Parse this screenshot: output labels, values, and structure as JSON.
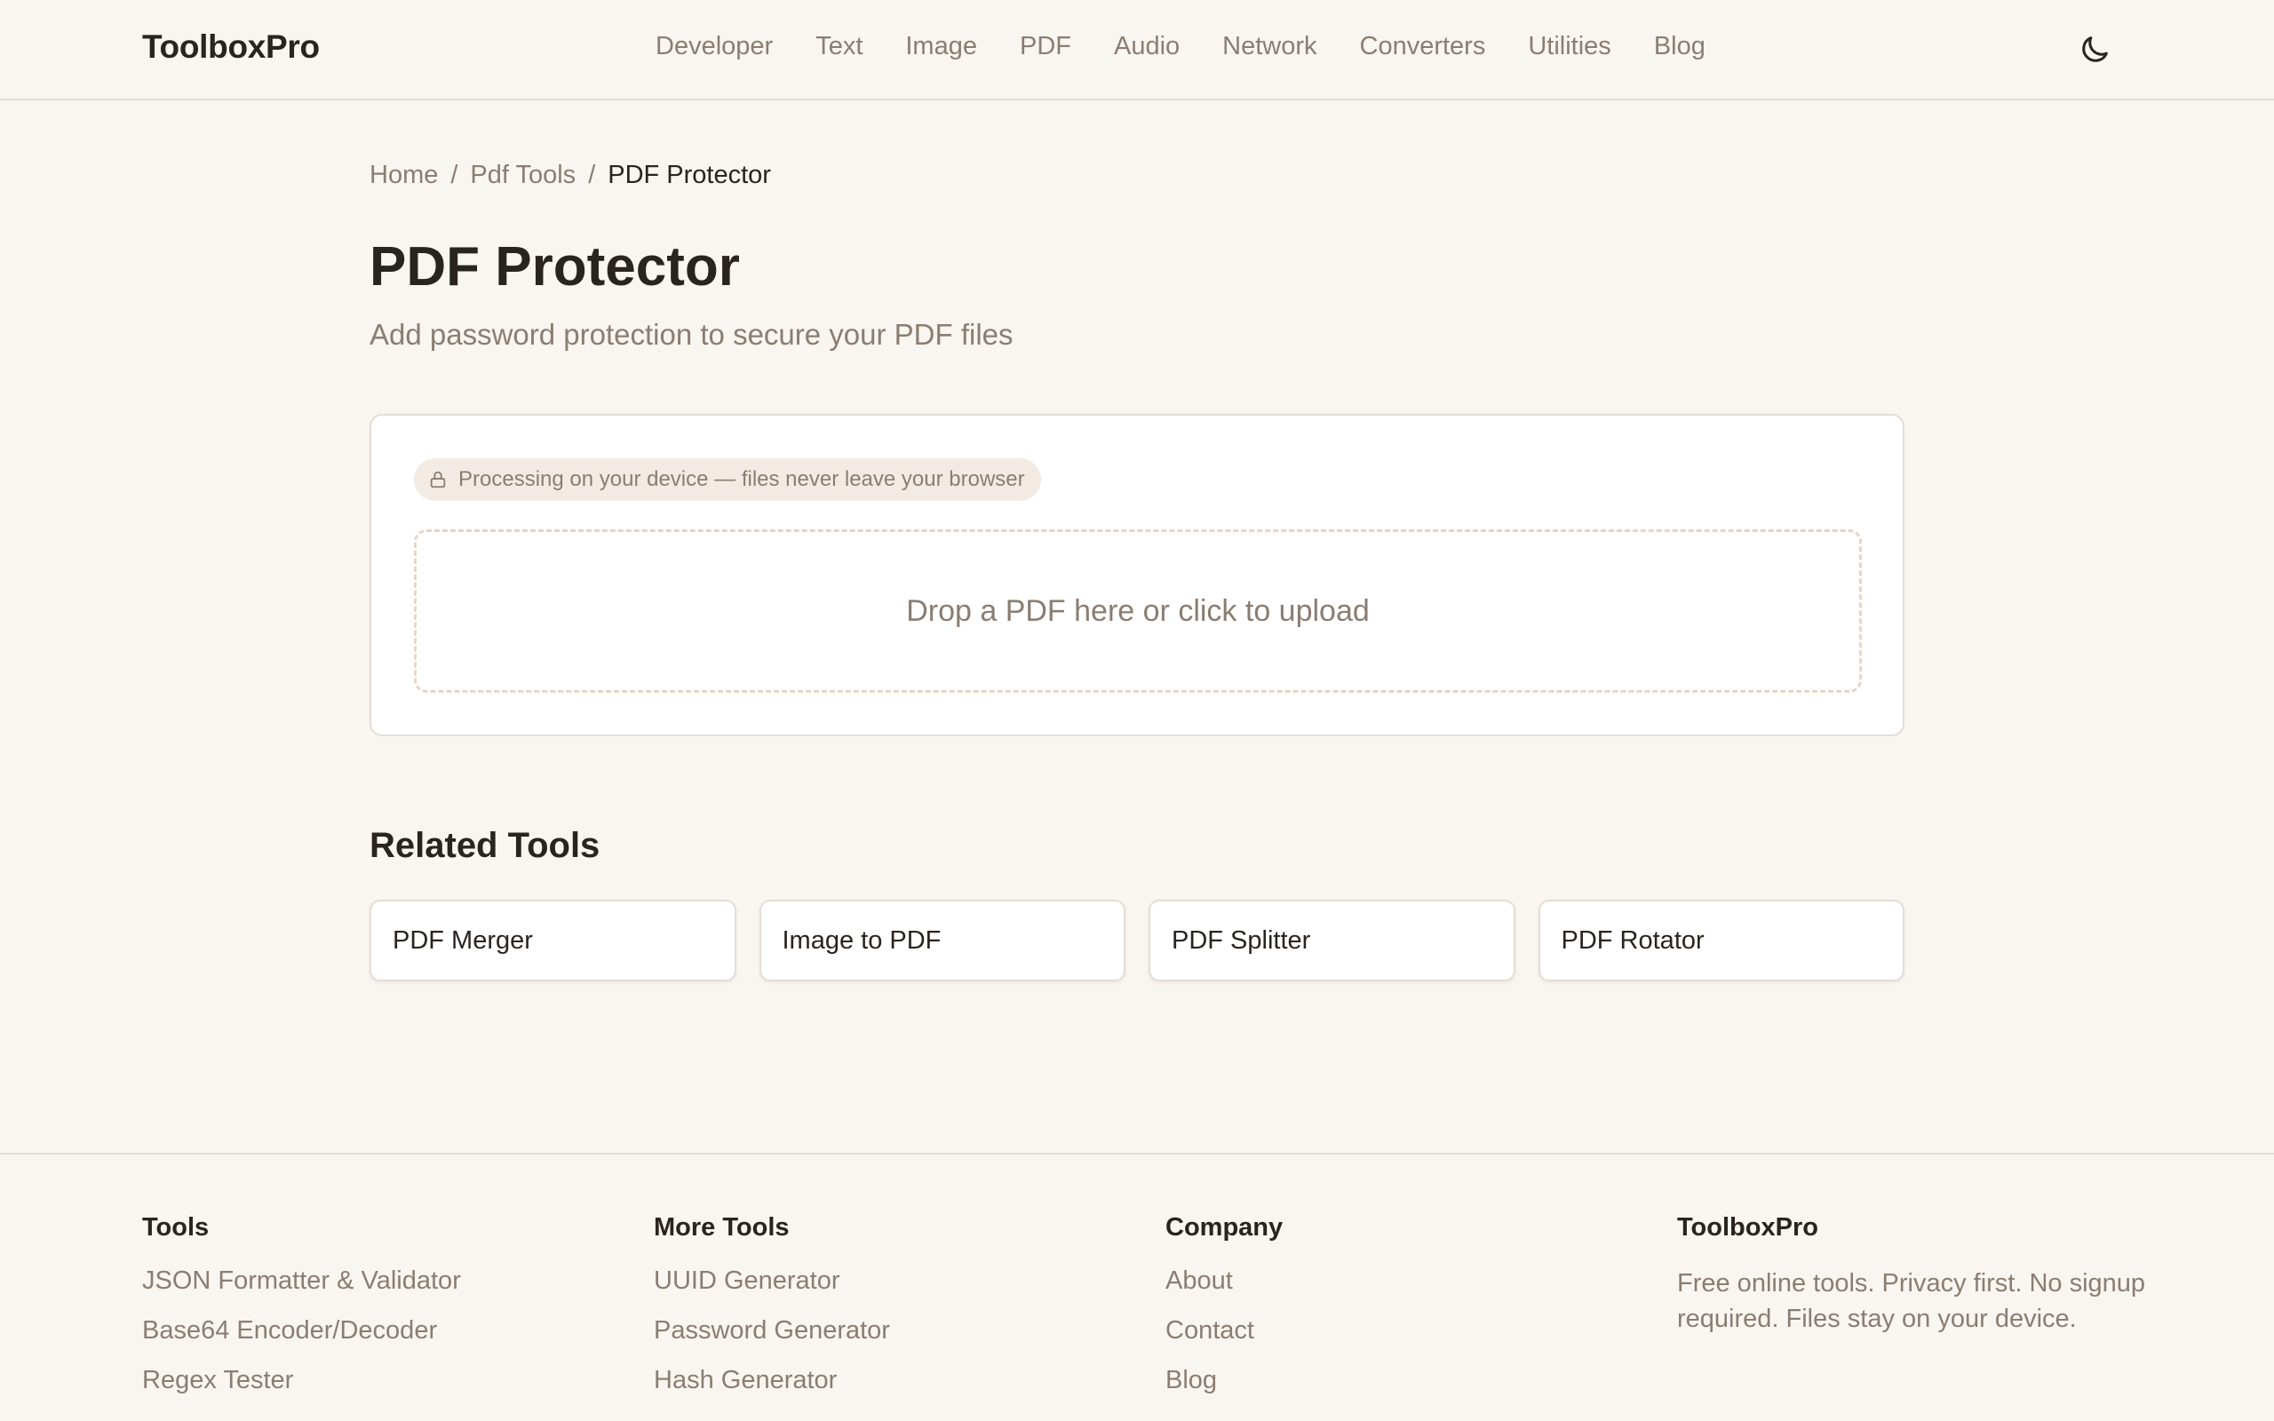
{
  "header": {
    "logo": "ToolboxPro",
    "nav": [
      "Developer",
      "Text",
      "Image",
      "PDF",
      "Audio",
      "Network",
      "Converters",
      "Utilities",
      "Blog"
    ],
    "theme_icon": "moon-icon"
  },
  "breadcrumb": {
    "home": "Home",
    "sep1": "/",
    "section": "Pdf Tools",
    "sep2": "/",
    "current": "PDF Protector"
  },
  "page": {
    "title": "PDF Protector",
    "subtitle": "Add password protection to secure your PDF files"
  },
  "tool": {
    "privacy_icon": "lock-icon",
    "privacy_text": "Processing on your device — files never leave your browser",
    "dropzone_text": "Drop a PDF here or click to upload"
  },
  "related": {
    "title": "Related Tools",
    "items": [
      "PDF Merger",
      "Image to PDF",
      "PDF Splitter",
      "PDF Rotator"
    ]
  },
  "footer": {
    "tools": {
      "heading": "Tools",
      "links": [
        "JSON Formatter & Validator",
        "Base64 Encoder/Decoder",
        "Regex Tester"
      ]
    },
    "more_tools": {
      "heading": "More Tools",
      "links": [
        "UUID Generator",
        "Password Generator",
        "Hash Generator"
      ]
    },
    "company": {
      "heading": "Company",
      "links": [
        "About",
        "Contact",
        "Blog"
      ]
    },
    "brand": {
      "heading": "ToolboxPro",
      "text": "Free online tools. Privacy first. No signup required. Files stay on your device."
    }
  },
  "colors": {
    "background": "#f9f5f1",
    "text": "#2a241f",
    "muted": "#8a7d72",
    "border": "#e3ddd7",
    "badge": "#f3ebe3",
    "dropzone_border": "#e4d5c9"
  }
}
